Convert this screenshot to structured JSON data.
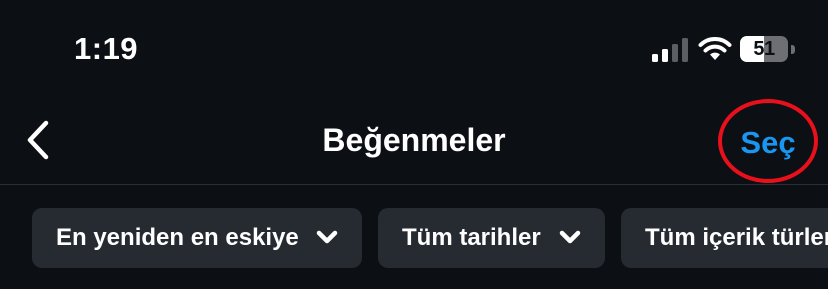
{
  "status_bar": {
    "time": "1:19",
    "battery_level": "51",
    "battery_fraction": 0.51,
    "signal_icon": "cellular-signal-icon",
    "wifi_icon": "wifi-icon",
    "battery_icon": "battery-icon"
  },
  "header": {
    "title": "Beğenmeler",
    "back_icon": "chevron-left-icon",
    "select_label": "Seç",
    "highlight_color": "#e8101a",
    "accent_color": "#1a96f0"
  },
  "filters": [
    {
      "label": "En yeniden en eskiye",
      "icon": "chevron-down-icon"
    },
    {
      "label": "Tüm tarihler",
      "icon": "chevron-down-icon"
    },
    {
      "label": "Tüm içerik türleri",
      "icon": "chevron-down-icon"
    }
  ],
  "colors": {
    "background": "#0c0f14",
    "chip_background": "#262a31",
    "text": "#ffffff"
  }
}
